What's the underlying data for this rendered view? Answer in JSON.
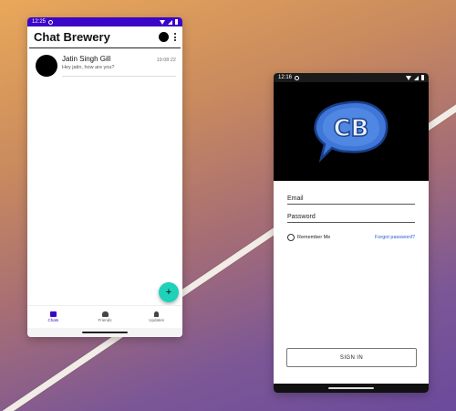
{
  "chat_screen": {
    "status_time": "12:25",
    "title": "Chat Brewery",
    "chats": [
      {
        "name": "Jatin Singh Gill",
        "time": "19:08:22",
        "message": "Hey jatin, how are you?"
      }
    ],
    "fab_label": "+",
    "nav": [
      {
        "label": "Chats",
        "active": true
      },
      {
        "label": "Friends",
        "active": false
      },
      {
        "label": "Updates",
        "active": false
      }
    ]
  },
  "login_screen": {
    "status_time": "12:16",
    "logo_text": "CB",
    "email_label": "Email",
    "password_label": "Password",
    "remember_label": "Remember Me",
    "forgot_label": "Forgot password?",
    "signin_label": "SIGN IN"
  },
  "colors": {
    "primary": "#3a06c8",
    "fab": "#1fd1b9",
    "link": "#2a5bd7",
    "logo_blue": "#3f77d8"
  }
}
